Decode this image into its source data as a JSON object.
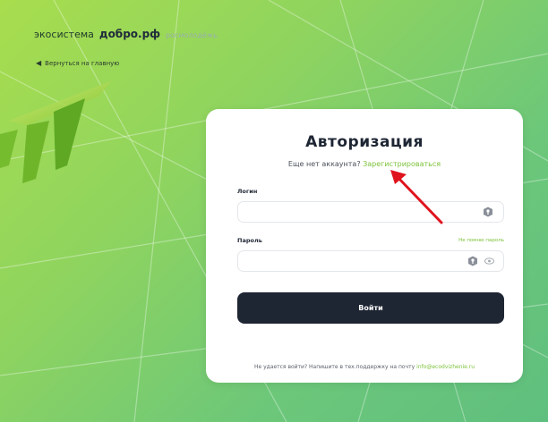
{
  "header": {
    "logo_part1": "экосистема",
    "logo_part2": "добро.рф",
    "logo_part3": "росмолодёжь",
    "back_link": "Вернуться на главную",
    "back_icon": "arrow-left-icon"
  },
  "login_card": {
    "title": "Авторизация",
    "no_account_text": "Еще нет аккаунта?",
    "register_link": "Зарегистрироваться",
    "login_label": "Логин",
    "login_value": "",
    "password_label": "Пароль",
    "password_value": "",
    "forgot_password": "Не помню пароль",
    "submit_label": "Войти",
    "support_text": "Не удается войти? Напишите в тех.поддержку на почту",
    "support_email": "info@ecodvizhenie.ru",
    "key_icon": "key-icon",
    "eye_icon": "eye-icon"
  },
  "colors": {
    "accent": "#7cc23a",
    "button_bg": "#1e2533",
    "annotation_arrow": "#e0141e"
  }
}
